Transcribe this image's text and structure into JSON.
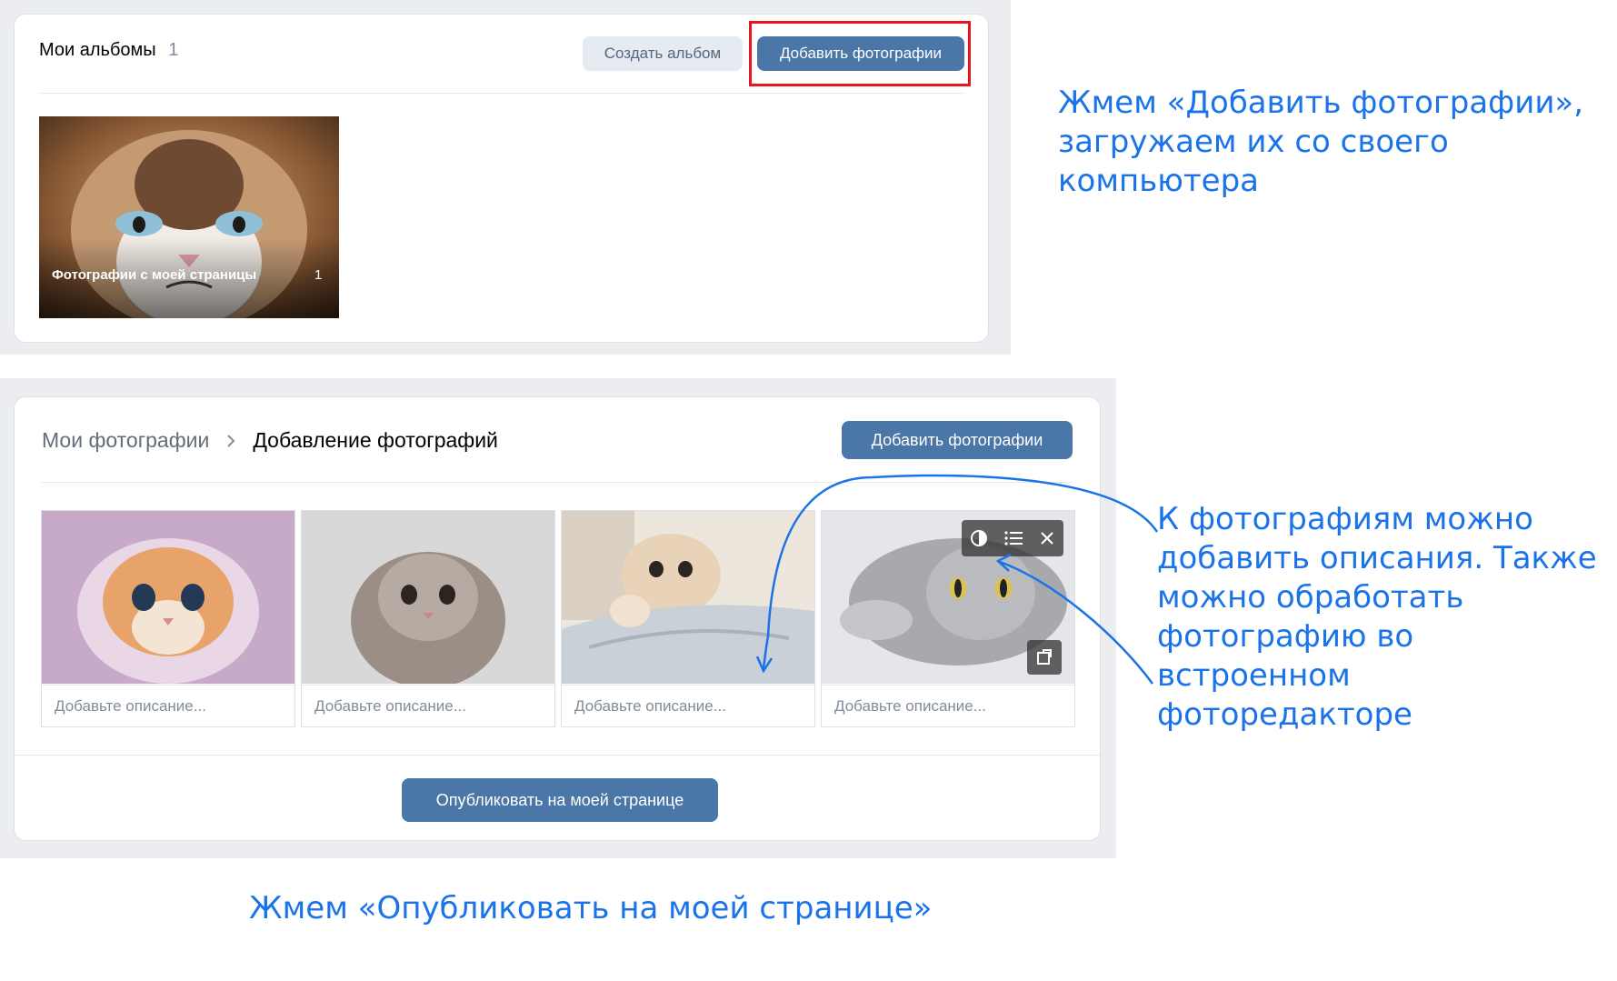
{
  "albums": {
    "title": "Мои альбомы",
    "count": "1",
    "create_album_label": "Создать альбом",
    "add_photos_label": "Добавить фотографии",
    "album_cards": [
      {
        "label": "Фотографии с моей страницы",
        "count": "1"
      }
    ]
  },
  "upload": {
    "breadcrumb_parent": "Мои фотографии",
    "breadcrumb_current": "Добавление фотографий",
    "add_photos_label": "Добавить фотографии",
    "description_placeholder": "Добавьте описание...",
    "publish_label": "Опубликовать на моей странице"
  },
  "annotations": {
    "step1": "Жмем «Добавить фотографии»,\nзагружаем их со своего\nкомпьютера",
    "step2": "К фотографиям можно\nдобавить описания. Также\nможно обработать\nфотографию во встроенном\nфоторедакторе",
    "step3": "Жмем «Опубликовать на моей странице»"
  },
  "colors": {
    "accent": "#4a76a8",
    "annotation": "#1a73e8",
    "highlight": "#e8141e",
    "panel": "#ebedf0"
  },
  "icons": [
    "contrast-icon",
    "list-icon",
    "close-icon",
    "rotate-icon",
    "chevron-right-icon"
  ]
}
